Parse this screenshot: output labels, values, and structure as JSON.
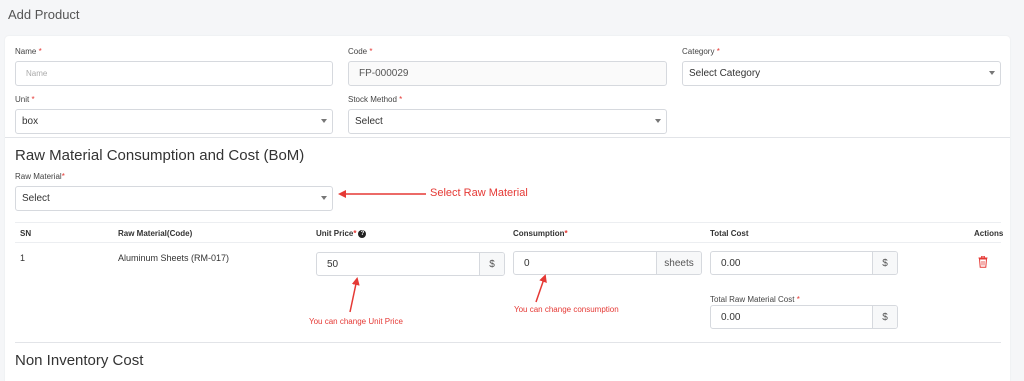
{
  "page": {
    "title": "Add Product"
  },
  "form": {
    "name": {
      "label": "Name",
      "required_mark": "*",
      "placeholder": "Name"
    },
    "code": {
      "label": "Code",
      "required_mark": "*",
      "value": "FP-000029"
    },
    "category": {
      "label": "Category",
      "required_mark": "*",
      "value": "Select Category"
    },
    "unit": {
      "label": "Unit",
      "required_mark": "*",
      "value": "box"
    },
    "stock_method": {
      "label": "Stock Method",
      "required_mark": "*",
      "value": "Select"
    }
  },
  "bom": {
    "title": "Raw Material Consumption and Cost (BoM)",
    "raw_material": {
      "label": "Raw Material",
      "required_mark": "*",
      "value": "Select"
    },
    "table": {
      "headers": {
        "sn": "SN",
        "material": "Raw Material(Code)",
        "unit_price": "Unit Price",
        "unit_price_req": "*",
        "consumption": "Consumption",
        "consumption_req": "*",
        "total_cost": "Total Cost",
        "actions": "Actions"
      },
      "rows": [
        {
          "sn": "1",
          "material": "Aluminum Sheets (RM-017)",
          "unit_price": "50",
          "currency": "$",
          "consumption": "0",
          "consumption_unit": "sheets",
          "total_cost": "0.00",
          "total_currency": "$"
        }
      ]
    },
    "total_raw_material_cost": {
      "label": "Total Raw Material Cost",
      "required_mark": "*",
      "value": "0.00",
      "currency": "$"
    }
  },
  "non_inventory": {
    "title": "Non Inventory Cost"
  },
  "annotations": {
    "select_raw": "Select Raw Material",
    "change_price": "You can change Unit Price",
    "change_consumption": "You can change consumption"
  },
  "colors": {
    "accent_red": "#e53935",
    "border": "#d6d9de"
  },
  "icons": {
    "help": "question-circle-icon",
    "delete": "trash-icon"
  }
}
